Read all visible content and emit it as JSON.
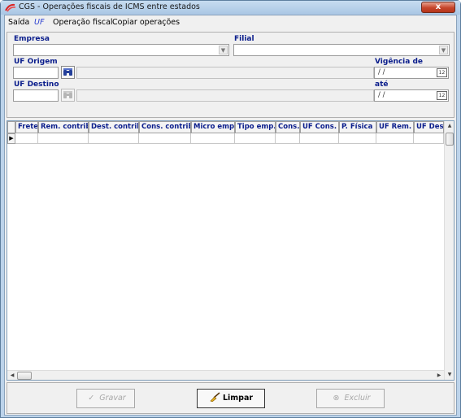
{
  "window": {
    "title": "CGS - Operações fiscais de ICMS entre estados",
    "close_label": "x"
  },
  "menu": {
    "items": [
      {
        "label": "Saída"
      },
      {
        "label": "UF"
      },
      {
        "label": "Operação fiscal"
      },
      {
        "label": "Copiar operações"
      }
    ]
  },
  "form": {
    "empresa_label": "Empresa",
    "empresa_value": "",
    "filial_label": "Filial",
    "filial_value": "",
    "uf_origem_label": "UF Origem",
    "uf_origem_value": "",
    "uf_destino_label": "UF Destino",
    "uf_destino_value": "",
    "vigencia_de_label": "Vigência de",
    "vigencia_de_value": "/ /",
    "ate_label": "até",
    "ate_value": "/ /",
    "calendar_glyph": "12"
  },
  "grid": {
    "columns": [
      "Frete",
      "Rem. contrib.",
      "Dest. contrib.",
      "Cons. contrib.",
      "Micro emp.",
      "Tipo emp.",
      "Cons.",
      "UF Cons.",
      "P. Física",
      "UF Rem.",
      "UF Des"
    ],
    "row_indicator": "▶"
  },
  "buttons": {
    "gravar": "Gravar",
    "limpar": "Limpar",
    "excluir": "Excluir"
  },
  "colors": {
    "label_blue": "#0a1d8c",
    "titlebar": "#bcd3ea",
    "close_red": "#c6452a"
  }
}
